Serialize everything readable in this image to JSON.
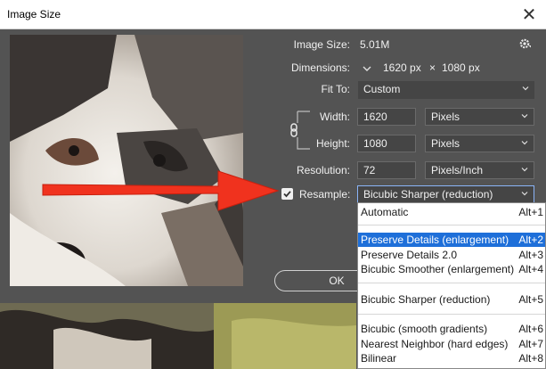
{
  "window": {
    "title": "Image Size",
    "close_glyph": "✕"
  },
  "info": {
    "image_size_label": "Image Size:",
    "image_size_value": "5.01M",
    "dimensions_label": "Dimensions:",
    "dimensions_w": "1620 px",
    "dimensions_x": "×",
    "dimensions_h": "1080 px",
    "fit_to_label": "Fit To:",
    "fit_to_value": "Custom"
  },
  "size": {
    "width_label": "Width:",
    "width_value": "1620",
    "width_unit": "Pixels",
    "height_label": "Height:",
    "height_value": "1080",
    "height_unit": "Pixels",
    "resolution_label": "Resolution:",
    "resolution_value": "72",
    "resolution_unit": "Pixels/Inch"
  },
  "resample": {
    "label": "Resample:",
    "checked": true,
    "value": "Bicubic Sharper (reduction)"
  },
  "buttons": {
    "ok": "OK"
  },
  "menu": {
    "items": [
      {
        "label": "Automatic",
        "shortcut": "Alt+1"
      },
      {
        "label": "Preserve Details (enlargement)",
        "shortcut": "Alt+2",
        "selected": true
      },
      {
        "label": "Preserve Details 2.0",
        "shortcut": "Alt+3"
      },
      {
        "label": "Bicubic Smoother (enlargement)",
        "shortcut": "Alt+4"
      },
      {
        "label": "Bicubic Sharper (reduction)",
        "shortcut": "Alt+5"
      },
      {
        "label": "Bicubic (smooth gradients)",
        "shortcut": "Alt+6"
      },
      {
        "label": "Nearest Neighbor (hard edges)",
        "shortcut": "Alt+7"
      },
      {
        "label": "Bilinear",
        "shortcut": "Alt+8"
      }
    ]
  },
  "colors": {
    "dialog_bg": "#535353",
    "field_bg": "#454545",
    "menu_selected": "#1e6fd9",
    "annotation_arrow": "#f0321e"
  },
  "icons": [
    "close-icon",
    "gear-icon",
    "chain-link-icon",
    "chevron-down-icon",
    "checkmark-icon",
    "red-arrow-annotation"
  ]
}
